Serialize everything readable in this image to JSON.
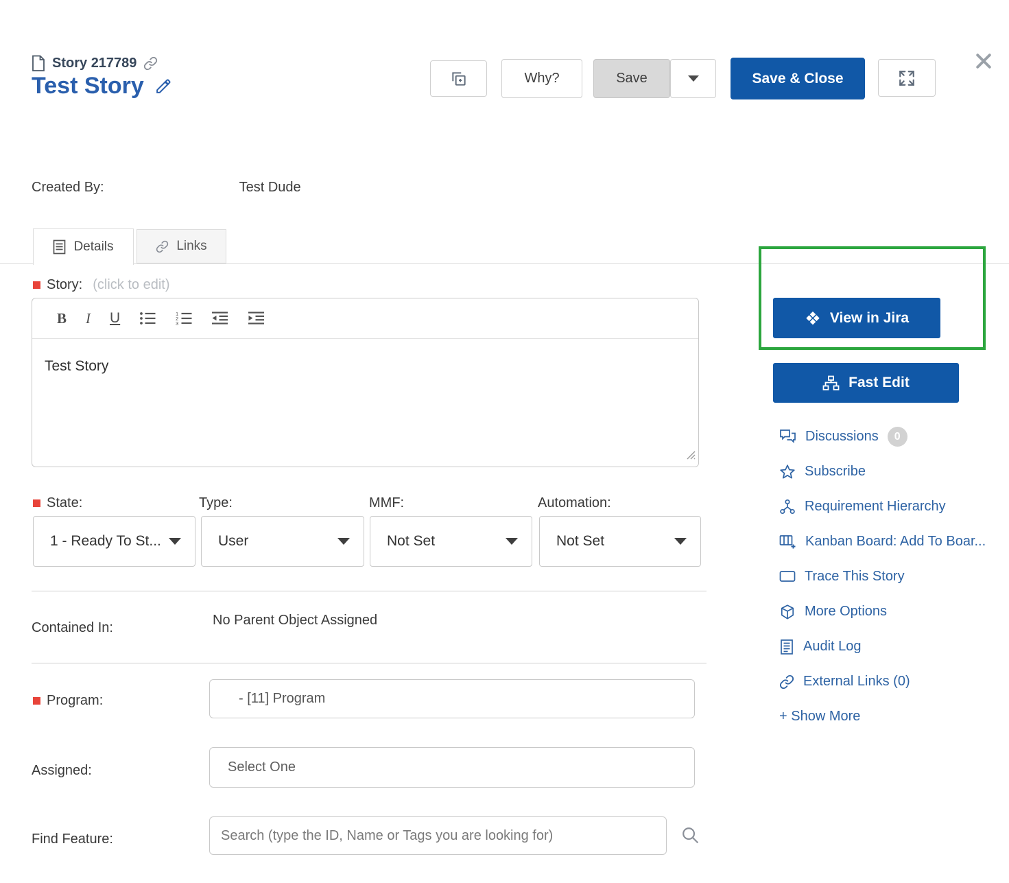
{
  "header": {
    "type_label": "Story",
    "id": "217789",
    "title": "Test Story",
    "buttons": {
      "why": "Why?",
      "save": "Save",
      "save_close": "Save & Close"
    }
  },
  "meta": {
    "created_by_label": "Created By:",
    "created_by_value": "Test Dude"
  },
  "tabs": [
    {
      "label": "Details"
    },
    {
      "label": "Links"
    }
  ],
  "story_editor": {
    "label": "Story:",
    "hint": "(click to edit)",
    "value": "Test Story",
    "toolbar": {
      "bold": "B",
      "italic": "I",
      "underline": "U"
    }
  },
  "selects": {
    "state": {
      "label": "State:",
      "value": "1 - Ready To St...",
      "required": true
    },
    "type": {
      "label": "Type:",
      "value": "User",
      "required": false
    },
    "mmf": {
      "label": "MMF:",
      "value": "Not Set",
      "required": false
    },
    "automation": {
      "label": "Automation:",
      "value": "Not Set",
      "required": false
    }
  },
  "fields": {
    "contained_in": {
      "label": "Contained In:",
      "value": "No Parent Object Assigned"
    },
    "program": {
      "label": "Program:",
      "value": "- [11] Program",
      "required": true
    },
    "assigned": {
      "label": "Assigned:",
      "value": "Select One"
    },
    "find_feature": {
      "label": "Find Feature:",
      "placeholder": "Search (type the ID, Name or Tags you are looking for)"
    }
  },
  "sidebar": {
    "view_in_jira": "View in Jira",
    "fast_edit": "Fast Edit",
    "links": [
      {
        "label": "Discussions",
        "badge": "0"
      },
      {
        "label": "Subscribe"
      },
      {
        "label": "Requirement Hierarchy"
      },
      {
        "label": "Kanban Board: Add To Boar..."
      },
      {
        "label": "Trace This Story"
      },
      {
        "label": "More Options"
      },
      {
        "label": "Audit Log"
      },
      {
        "label": "External Links (0)"
      },
      {
        "label": "+ Show More"
      }
    ]
  },
  "colors": {
    "primary_blue": "#1158a7",
    "link_blue": "#2e63a4",
    "highlight_green": "#2ca63e",
    "required_red": "#e8443a"
  }
}
